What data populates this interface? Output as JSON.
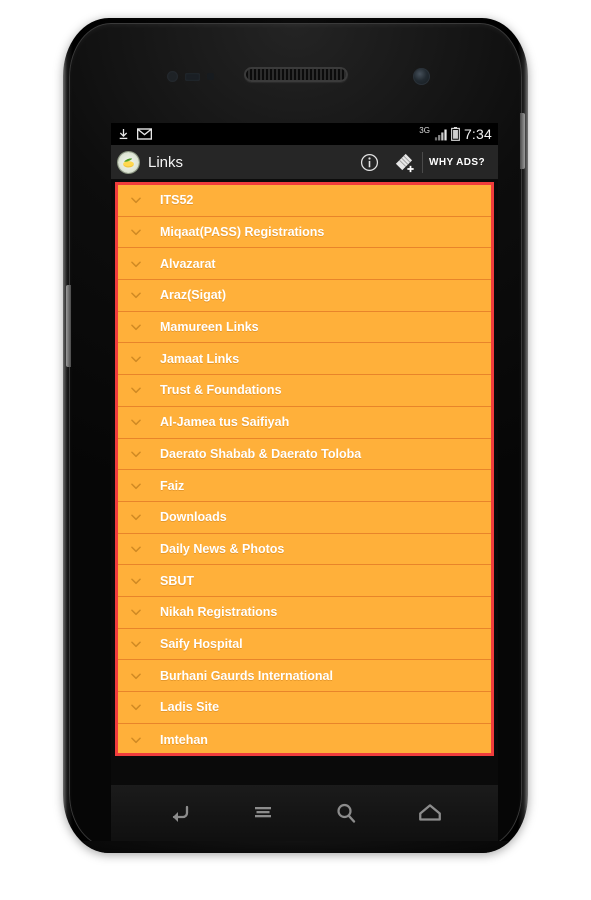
{
  "status_bar": {
    "left_icons": [
      "download-icon",
      "mail-icon"
    ],
    "network": "3G",
    "signal_icon": "signal-bars-icon",
    "battery_icon": "battery-icon",
    "time": "7:34"
  },
  "action_bar": {
    "app_icon": "app-logo-icon",
    "title": "Links",
    "info_icon": "info-icon",
    "tag_add_icon": "tag-add-icon",
    "why_ads_label": "WHY ADS?"
  },
  "list": {
    "chevron_icon": "chevron-down-icon",
    "items": [
      {
        "label": "ITS52"
      },
      {
        "label": "Miqaat(PASS) Registrations"
      },
      {
        "label": "Alvazarat"
      },
      {
        "label": "Araz(Sigat)"
      },
      {
        "label": "Mamureen Links"
      },
      {
        "label": "Jamaat Links"
      },
      {
        "label": "Trust & Foundations"
      },
      {
        "label": "Al-Jamea tus Saifiyah"
      },
      {
        "label": "Daerato Shabab & Daerato Toloba"
      },
      {
        "label": "Faiz"
      },
      {
        "label": "Downloads"
      },
      {
        "label": "Daily News & Photos"
      },
      {
        "label": "SBUT"
      },
      {
        "label": "Nikah Registrations"
      },
      {
        "label": "Saify Hospital"
      },
      {
        "label": "Burhani Gaurds International"
      },
      {
        "label": "Ladis Site"
      },
      {
        "label": "Imtehan"
      }
    ]
  },
  "nav_bar": {
    "back_icon": "back-icon",
    "menu_icon": "menu-icon",
    "search_icon": "search-icon",
    "home_icon": "home-icon"
  },
  "colors": {
    "list_background": "#ffb03a",
    "list_border": "#f03c3c",
    "row_divider": "#e8842a",
    "action_bar": "#262626",
    "label_text": "#ffffff"
  }
}
